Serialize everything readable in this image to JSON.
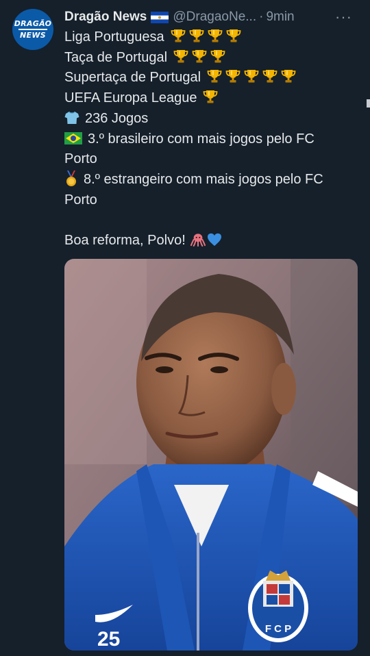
{
  "tweet": {
    "author_name": "Dragão News",
    "handle": "@DragaoNe...",
    "separator": "·",
    "time": "9min",
    "more_label": "···",
    "avatar_text": {
      "line1": "DRAGÃO",
      "line2": "NEWS"
    },
    "lines": [
      {
        "text": "Liga Portuguesa",
        "trophies": 4
      },
      {
        "text": "Taça de Portugal",
        "trophies": 3
      },
      {
        "text": "Supertaça de Portugal",
        "trophies": 5
      },
      {
        "text": "UEFA Europa League",
        "trophies": 1
      }
    ],
    "stat_games": "236 Jogos",
    "stat_brazilian_1": "3.º brasileiro com mais jogos pelo FC",
    "stat_brazilian_2": "Porto",
    "stat_foreign_1": "8.º estrangeiro com mais jogos pelo FC",
    "stat_foreign_2": "Porto",
    "closing": "Boa reforma, Polvo!",
    "photo": {
      "jersey_number": "25",
      "crest_text": "F C P"
    }
  },
  "colors": {
    "background": "#15202b",
    "text": "#e7e9ea",
    "muted": "#8b98a5",
    "jersey_blue": "#1f55b4"
  },
  "icons": [
    "salvadoran-flag-icon",
    "trophy-icon",
    "shirt-icon",
    "brazil-flag-icon",
    "medal-icon",
    "octopus-icon",
    "blue-heart-icon",
    "more-icon"
  ]
}
